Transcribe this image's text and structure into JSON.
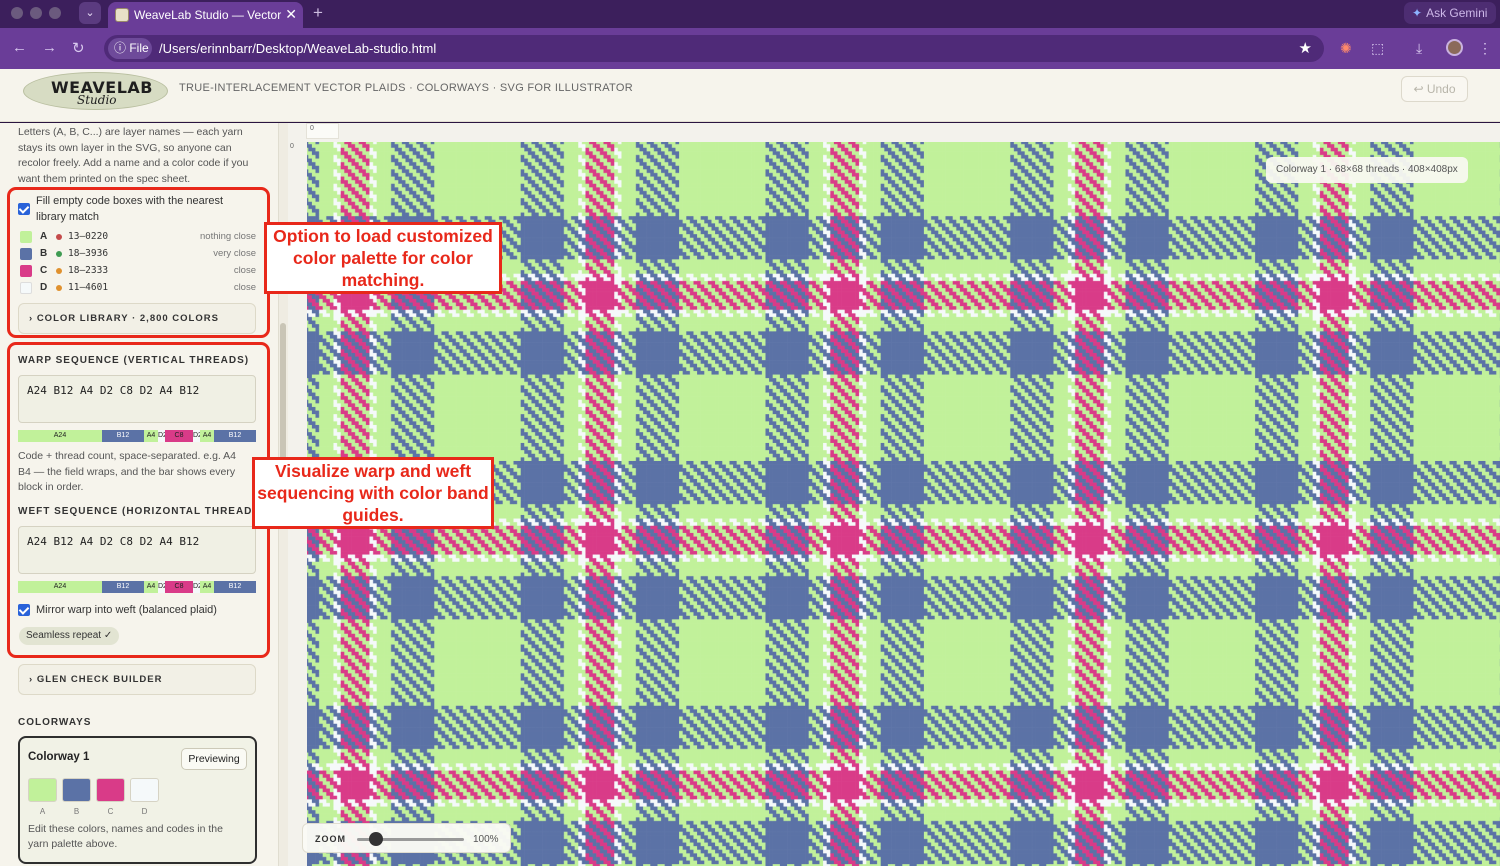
{
  "browser": {
    "tab_title": "WeaveLab Studio — Vector Plaid",
    "new_tab_icon": "+",
    "gemini_label": "Ask Gemini",
    "file_chip": "File",
    "url": "/Users/erinnbarr/Desktop/WeaveLab-studio.html"
  },
  "header": {
    "logo_main": "WEAVELAB",
    "logo_sub": "Studio",
    "tagline": "TRUE-INTERLACEMENT VECTOR PLAIDS · COLORWAYS · SVG FOR ILLUSTRATOR",
    "undo_label": "↩ Undo"
  },
  "sidebar": {
    "intro_lines": [
      "Letters (A, B, C...) are layer names — each yarn",
      "stays its own layer in the SVG, so anyone can",
      "recolor freely. Add a name and a color code if you",
      "want them printed on the spec sheet."
    ],
    "fill_codes_lines": [
      "Fill empty code boxes with the nearest",
      "library match"
    ],
    "palette": [
      {
        "letter": "A",
        "code": "13–0220",
        "status": "nothing close",
        "swatch": "#c1f19a",
        "dot": "#c44a4a"
      },
      {
        "letter": "B",
        "code": "18–3936",
        "status": "very close",
        "swatch": "#5b72a6",
        "dot": "#3f9b52"
      },
      {
        "letter": "C",
        "code": "18–2333",
        "status": "close",
        "swatch": "#d93b88",
        "dot": "#e0912e"
      },
      {
        "letter": "D",
        "code": "11–4601",
        "status": "close",
        "swatch": "#f5f9fa",
        "dot": "#e0912e"
      }
    ],
    "color_library_label": "COLOR LIBRARY · 2,800 COLORS",
    "warp_header": "WARP SEQUENCE (VERTICAL THREADS)",
    "warp_value": "A24 B12 A4 D2 C8 D2 A4 B12",
    "help_lines": [
      "Code + thread count, space-separated. e.g. A4",
      "B4 — the field wraps, and the bar shows every",
      "block in order."
    ],
    "weft_header": "WEFT SEQUENCE (HORIZONTAL THREADS)",
    "weft_value": "A24 B12 A4 D2 C8 D2 A4 B12",
    "mirror_label": "Mirror warp into weft (balanced plaid)",
    "seamless_label": "Seamless repeat ✓",
    "glen_check_label": "GLEN CHECK BUILDER",
    "colorways_header": "COLORWAYS",
    "colorway": {
      "name": "Colorway 1",
      "preview_label": "Previewing",
      "swatches": [
        {
          "letter": "A",
          "color": "#c1f19a"
        },
        {
          "letter": "B",
          "color": "#5b72a6"
        },
        {
          "letter": "C",
          "color": "#d93b88"
        },
        {
          "letter": "D",
          "color": "#f5f9fa"
        }
      ],
      "note_lines": [
        "Edit these colors, names and codes in the",
        "yarn palette above."
      ]
    }
  },
  "sequence": [
    {
      "code": "A",
      "count": 24
    },
    {
      "code": "B",
      "count": 12
    },
    {
      "code": "A",
      "count": 4
    },
    {
      "code": "D",
      "count": 2
    },
    {
      "code": "C",
      "count": 8
    },
    {
      "code": "D",
      "count": 2
    },
    {
      "code": "A",
      "count": 4
    },
    {
      "code": "B",
      "count": 12
    }
  ],
  "canvas": {
    "info_badge": "Colorway 1 · 68×68 threads · 408×408px",
    "zoom_label": "ZOOM",
    "zoom_value": "100%",
    "zoom_fraction": 0.18,
    "ruler_origin_label": "0"
  },
  "annotations": {
    "palette_callout": "Option to load customized color palette for color matching.",
    "sequence_callout": "Visualize warp and weft sequencing with color band guides."
  },
  "colors": {
    "A": "#c1f19a",
    "B": "#5b72a6",
    "C": "#d93b88",
    "D": "#f5f9fa",
    "annotation_red": "#e8281a"
  }
}
